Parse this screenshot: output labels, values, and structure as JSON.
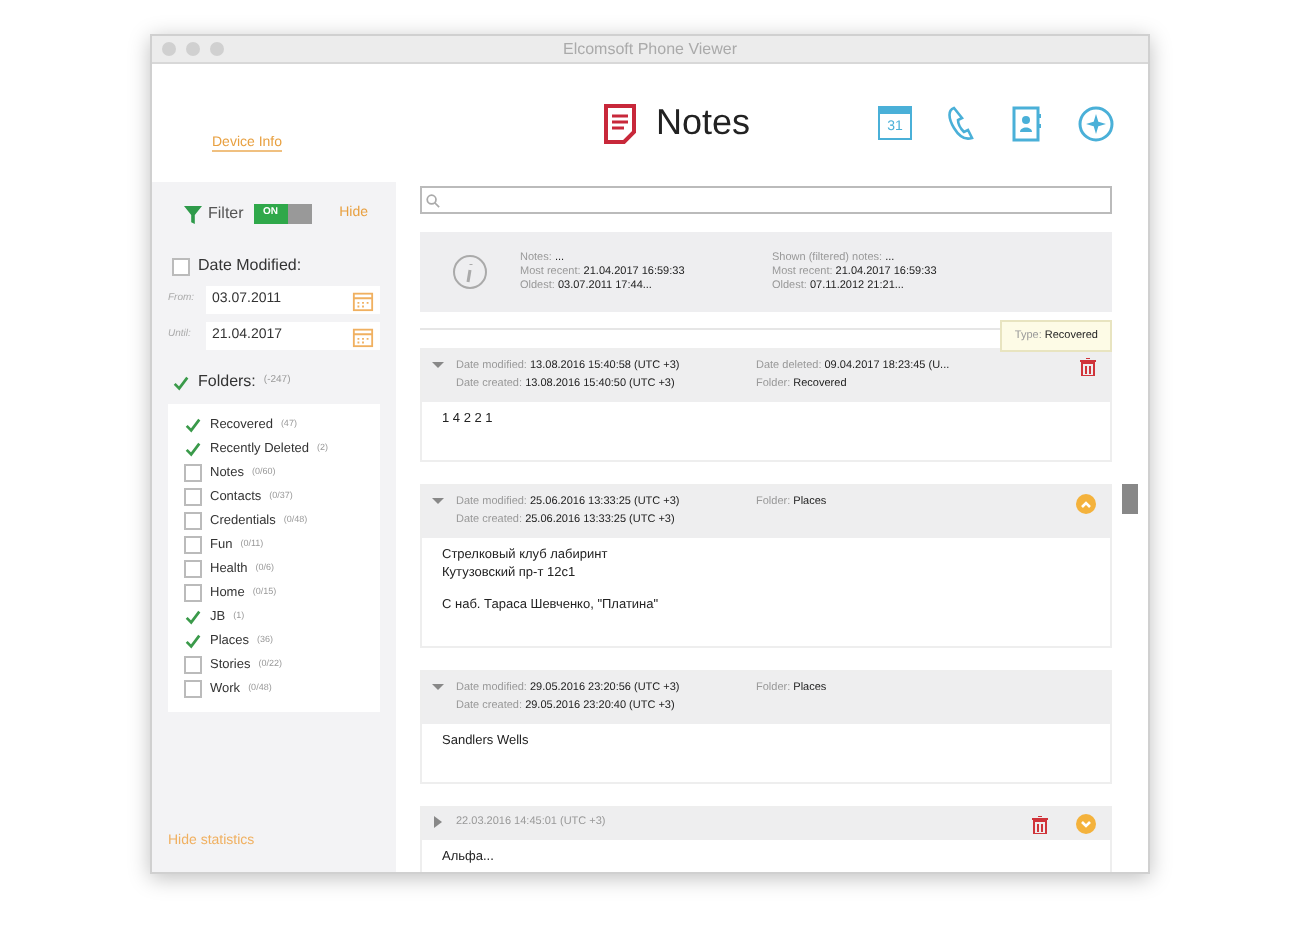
{
  "window": {
    "title": "Elcomsoft Phone Viewer"
  },
  "header": {
    "device_info": "Device Info",
    "title": "Notes",
    "calendar_day": "31"
  },
  "sidebar": {
    "filter": {
      "label": "Filter",
      "toggle": {
        "on": true,
        "label": "ON"
      },
      "hide": "Hide"
    },
    "date_modified": {
      "label": "Date Modified:",
      "checked": false,
      "from": {
        "label": "From:",
        "value": "03.07.2011"
      },
      "until": {
        "label": "Until:",
        "value": "21.04.2017"
      }
    },
    "folders": {
      "label": "Folders:",
      "count": "(-247)",
      "checked": true,
      "items": [
        {
          "name": "Recovered",
          "count": "(47)",
          "checked": true
        },
        {
          "name": "Recently Deleted",
          "count": "(2)",
          "checked": true
        },
        {
          "name": "Notes",
          "count": "(0/60)",
          "checked": false
        },
        {
          "name": "Contacts",
          "count": "(0/37)",
          "checked": false
        },
        {
          "name": "Credentials",
          "count": "(0/48)",
          "checked": false
        },
        {
          "name": "Fun",
          "count": "(0/11)",
          "checked": false
        },
        {
          "name": "Health",
          "count": "(0/6)",
          "checked": false
        },
        {
          "name": "Home",
          "count": "(0/15)",
          "checked": false
        },
        {
          "name": "JB",
          "count": "(1)",
          "checked": true
        },
        {
          "name": "Places",
          "count": "(36)",
          "checked": true
        },
        {
          "name": "Stories",
          "count": "(0/22)",
          "checked": false
        },
        {
          "name": "Work",
          "count": "(0/48)",
          "checked": false
        }
      ]
    },
    "hide_statistics": "Hide statistics"
  },
  "stats": {
    "columns": [
      [
        {
          "label": "Notes:",
          "value": "..."
        },
        {
          "label": "Most recent:",
          "value": "21.04.2017 16:59:33"
        },
        {
          "label": "Oldest:",
          "value": "03.07.2011 17:44..."
        }
      ],
      [
        {
          "label": "Shown (filtered) notes:",
          "value": "..."
        },
        {
          "label": "Most recent:",
          "value": "21.04.2017 16:59:33"
        },
        {
          "label": "Oldest:",
          "value": "07.11.2012 21:21..."
        }
      ]
    ]
  },
  "tooltip": {
    "label": "Type:",
    "value": "Recovered"
  },
  "notes": [
    {
      "expanded": true,
      "deleted": true,
      "flagged": false,
      "fields": [
        {
          "label": "Date modified:",
          "value": "13.08.2016 15:40:58 (UTC +3)"
        },
        {
          "label": "Date deleted:",
          "value": "09.04.2017 18:23:45 (U..."
        },
        {
          "label": "Date created:",
          "value": "13.08.2016 15:40:50 (UTC +3)"
        },
        {
          "label": "Folder:",
          "value": "Recovered"
        }
      ],
      "paragraphs": [
        "1 4 2 2 1"
      ]
    },
    {
      "expanded": true,
      "deleted": false,
      "flagged": true,
      "fields": [
        {
          "label": "Date modified:",
          "value": "25.06.2016 13:33:25 (UTC +3)"
        },
        {
          "label": "Folder:",
          "value": "Places"
        },
        {
          "label": "Date created:",
          "value": "25.06.2016 13:33:25 (UTC +3)"
        }
      ],
      "paragraphs": [
        "Стрелковый клуб лабиринт\nКутузовский пр-т 12c1",
        "С наб. Тараса Шевченко, \"Платина\""
      ]
    },
    {
      "expanded": true,
      "deleted": false,
      "flagged": false,
      "fields": [
        {
          "label": "Date modified:",
          "value": "29.05.2016 23:20:56 (UTC +3)"
        },
        {
          "label": "Folder:",
          "value": "Places"
        },
        {
          "label": "Date created:",
          "value": "29.05.2016 23:20:40 (UTC +3)"
        }
      ],
      "paragraphs": [
        "Sandlers Wells"
      ]
    },
    {
      "expanded": false,
      "deleted": true,
      "flagged": true,
      "date": "22.03.2016 14:45:01 (UTC +3)",
      "paragraphs": [
        "Альфа..."
      ]
    }
  ]
}
